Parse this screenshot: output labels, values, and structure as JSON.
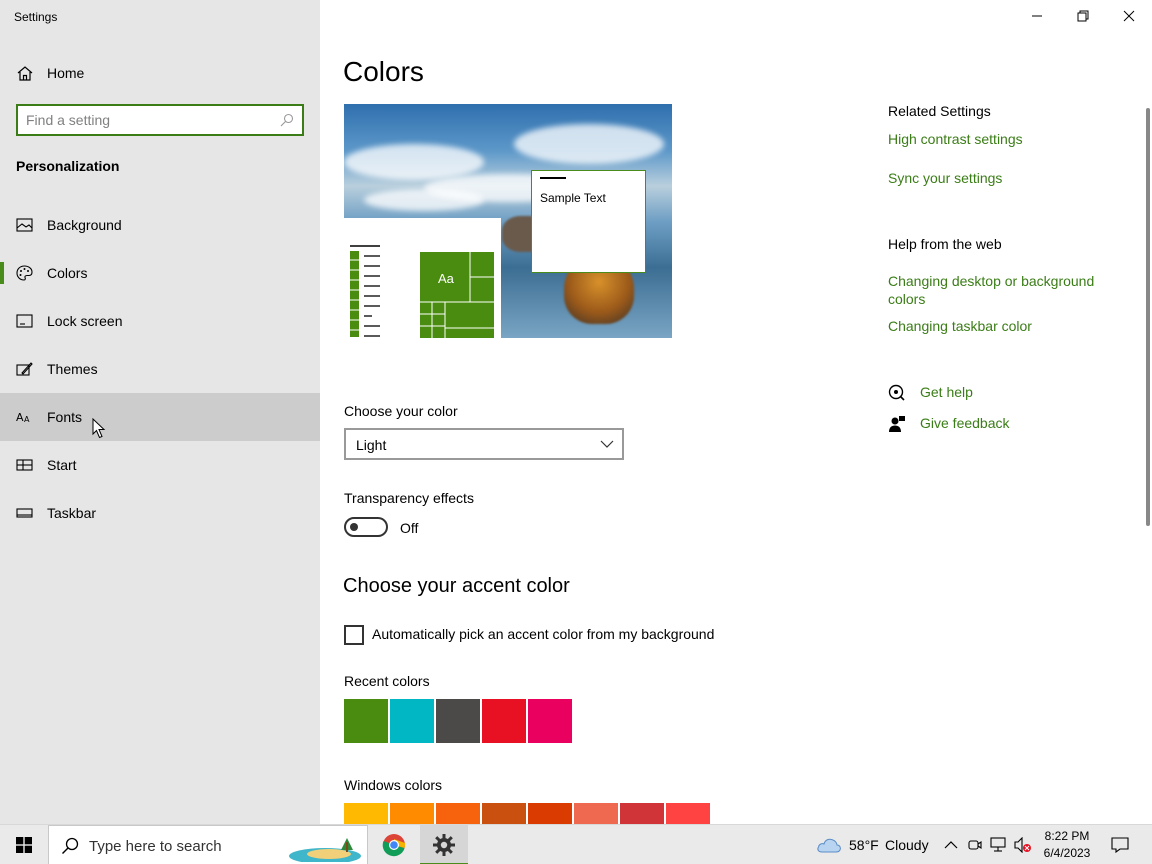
{
  "window": {
    "title": "Settings"
  },
  "sidebar": {
    "home_label": "Home",
    "search_placeholder": "Find a setting",
    "section_title": "Personalization",
    "items": [
      {
        "label": "Background",
        "icon": "image-icon"
      },
      {
        "label": "Colors",
        "icon": "palette-icon",
        "active": true
      },
      {
        "label": "Lock screen",
        "icon": "lock-screen-icon"
      },
      {
        "label": "Themes",
        "icon": "themes-icon"
      },
      {
        "label": "Fonts",
        "icon": "fonts-icon",
        "hovered": true
      },
      {
        "label": "Start",
        "icon": "start-icon"
      },
      {
        "label": "Taskbar",
        "icon": "taskbar-icon"
      }
    ]
  },
  "main": {
    "title": "Colors",
    "preview_sample_text": "Sample Text",
    "preview_tile_text": "Aa",
    "choose_color_label": "Choose your color",
    "choose_color_value": "Light",
    "transparency_label": "Transparency effects",
    "transparency_state": "Off",
    "accent_heading": "Choose your accent color",
    "auto_accent_label": "Automatically pick an accent color from my background",
    "recent_colors_label": "Recent colors",
    "recent_colors": [
      "#4a8c0f",
      "#00b7c3",
      "#4c4a48",
      "#e81123",
      "#ea005e"
    ],
    "windows_colors_label": "Windows colors",
    "windows_colors": [
      "#ffb900",
      "#ff8c00",
      "#f7630c",
      "#ca5010",
      "#da3b01",
      "#ef6950",
      "#d13438",
      "#ff4343"
    ]
  },
  "right": {
    "related_heading": "Related Settings",
    "related_links": [
      "High contrast settings",
      "Sync your settings"
    ],
    "help_heading": "Help from the web",
    "help_links": [
      "Changing desktop or background colors",
      "Changing taskbar color"
    ],
    "get_help": "Get help",
    "give_feedback": "Give feedback"
  },
  "taskbar": {
    "search_placeholder": "Type here to search",
    "weather_temp": "58°F",
    "weather_desc": "Cloudy",
    "time": "8:22 PM",
    "date": "6/4/2023"
  },
  "colors": {
    "accent": "#3a7d16",
    "sidebar_bg": "#e6e6e6",
    "hover_bg": "#cccccc"
  }
}
